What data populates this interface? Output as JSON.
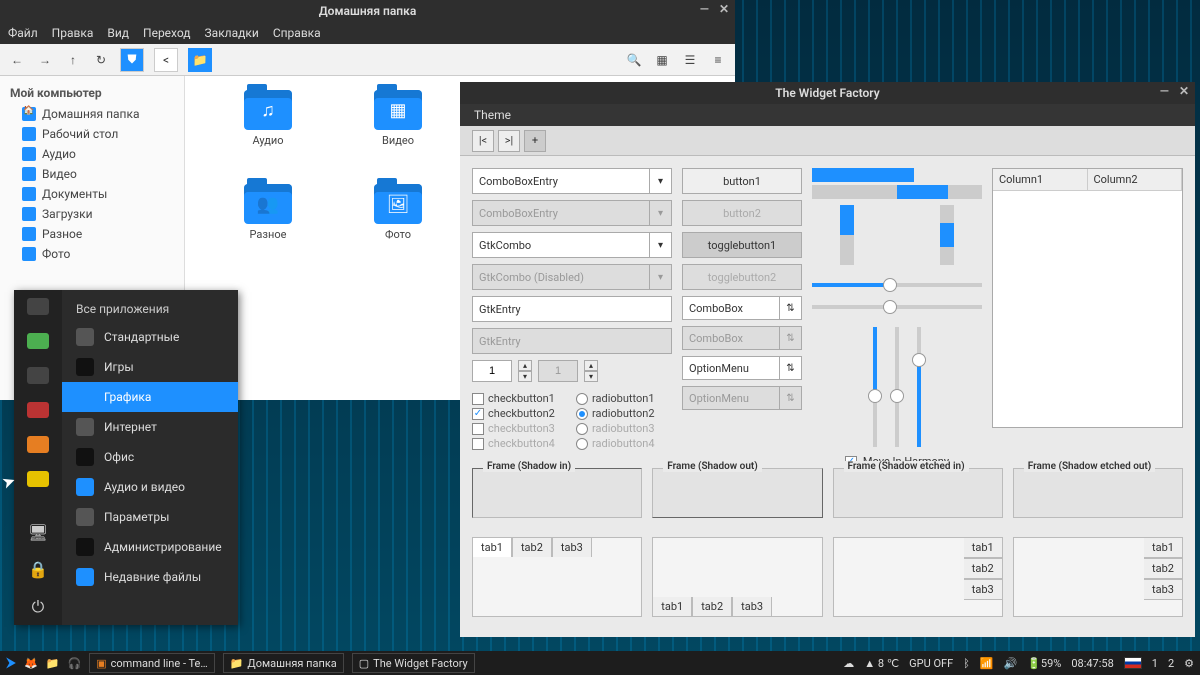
{
  "filemgr": {
    "title": "Домашняя папка",
    "menu": [
      "Файл",
      "Правка",
      "Вид",
      "Переход",
      "Закладки",
      "Справка"
    ],
    "sidebar_head": "Мой компьютер",
    "sidebar": [
      {
        "label": "Домашняя папка"
      },
      {
        "label": "Рабочий стол"
      },
      {
        "label": "Аудио"
      },
      {
        "label": "Видео"
      },
      {
        "label": "Документы"
      },
      {
        "label": "Загрузки"
      },
      {
        "label": "Разное"
      },
      {
        "label": "Фото"
      }
    ],
    "items": [
      {
        "label": "Аудио",
        "glyph": "♫"
      },
      {
        "label": "Видео",
        "glyph": "▦"
      },
      {
        "label": "Разное",
        "glyph": "👥"
      },
      {
        "label": "Фото",
        "glyph": "🖼"
      }
    ]
  },
  "appmenu": {
    "head": "Все приложения",
    "items": [
      {
        "label": "Стандартные"
      },
      {
        "label": "Игры"
      },
      {
        "label": "Графика",
        "selected": true
      },
      {
        "label": "Интернет"
      },
      {
        "label": "Офис"
      },
      {
        "label": "Аудио и видео"
      },
      {
        "label": "Параметры"
      },
      {
        "label": "Администрирование"
      },
      {
        "label": "Недавние файлы"
      }
    ]
  },
  "widget": {
    "title": "The Widget Factory",
    "menu": "Theme",
    "combo1": "ComboBoxEntry",
    "combo1_disabled": "ComboBoxEntry",
    "combo2": "GtkCombo",
    "combo2_disabled": "GtkCombo (Disabled)",
    "entry": "GtkEntry",
    "entry_disabled": "GtkEntry",
    "spin1": "1",
    "spin2": "1",
    "checks": [
      "checkbutton1",
      "checkbutton2",
      "checkbutton3",
      "checkbutton4"
    ],
    "radios": [
      "radiobutton1",
      "radiobutton2",
      "radiobutton3",
      "radiobutton4"
    ],
    "btn1": "button1",
    "btn2": "button2",
    "toggle1": "togglebutton1",
    "toggle2": "togglebutton2",
    "combosel": "ComboBox",
    "combosel_dis": "ComboBox",
    "optmenu": "OptionMenu",
    "optmenu_dis": "OptionMenu",
    "harmony": "Move In Harmony",
    "col1": "Column1",
    "col2": "Column2",
    "frames": [
      "Frame (Shadow in)",
      "Frame (Shadow out)",
      "Frame (Shadow etched in)",
      "Frame (Shadow etched out)"
    ],
    "tabs": [
      "tab1",
      "tab2",
      "tab3"
    ]
  },
  "taskbar": {
    "apps": [
      {
        "label": "command line - Te…"
      },
      {
        "label": "Домашняя папка"
      },
      {
        "label": "The Widget Factory"
      }
    ],
    "weather": "8 ℃",
    "gpu": "GPU OFF",
    "battery": "59%",
    "clock": "08:47:58",
    "ws1": "1",
    "ws2": "2"
  }
}
